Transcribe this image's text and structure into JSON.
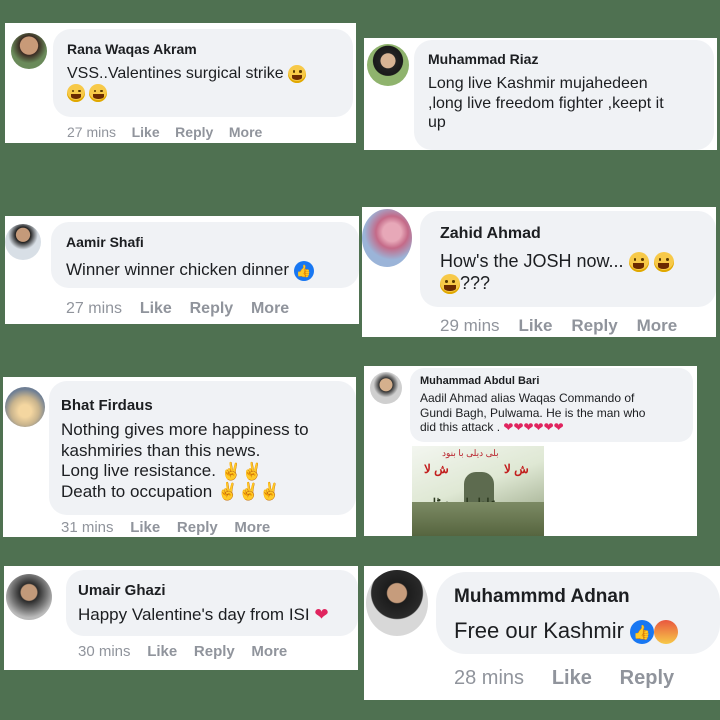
{
  "comments": [
    {
      "author": "Rana Waqas Akram",
      "lines": [
        "VSS..Valentines surgical strike",
        ""
      ],
      "time": "27 mins",
      "actions": [
        "Like",
        "Reply",
        "More"
      ],
      "avatar_icon": "man-portrait"
    },
    {
      "author": "Muhammad Riaz",
      "lines": [
        "Long live Kashmir mujahedeen",
        ",long live freedom fighter ,keept it",
        "up"
      ],
      "time": "",
      "actions": [],
      "avatar_icon": "man-in-black"
    },
    {
      "author": "Aamir Shafi",
      "lines": [
        "Winner winner chicken dinner"
      ],
      "time": "27 mins",
      "actions": [
        "Like",
        "Reply",
        "More"
      ],
      "avatar_icon": "man-in-jersey"
    },
    {
      "author": "Zahid Ahmad",
      "lines": [
        "How's the JOSH now...",
        "???"
      ],
      "time": "29 mins",
      "actions": [
        "Like",
        "Reply",
        "More"
      ],
      "avatar_icon": "flower-avatar"
    },
    {
      "author": "Bhat Firdaus",
      "lines": [
        "Nothing gives more happiness to",
        "kashmiries than this news.",
        "Long live resistance.",
        "Death to occupation"
      ],
      "time": "31 mins",
      "actions": [
        "Like",
        "Reply",
        "More"
      ],
      "avatar_icon": "sunset-avatar"
    },
    {
      "author": "Muhammad Abdul Bari",
      "lines": [
        "Aadil Ahmad alias Waqas Commando of",
        "Gundi Bagh, Pulwama. He is the man who",
        "did this attack ."
      ],
      "time": "",
      "actions": [],
      "avatar_icon": "man-portrait",
      "attachment": {
        "top_urdu": "بلی دیلی با بنود",
        "tag_left": "ش لا",
        "tag_right": "ش لا",
        "urdu_mid": "عادل احمد ڈار"
      }
    },
    {
      "author": "Umair Ghazi",
      "lines": [
        "Happy Valentine's day from ISI"
      ],
      "time": "30 mins",
      "actions": [
        "Like",
        "Reply",
        "More"
      ],
      "avatar_icon": "man-portrait"
    },
    {
      "author": "Muhammmd Adnan",
      "lines": [
        "Free our Kashmir"
      ],
      "time": "28 mins",
      "actions": [
        "Like",
        "Reply"
      ],
      "avatar_icon": "man-in-suit"
    }
  ],
  "colors": {
    "background": "#4f7151",
    "bubble": "#f0f2f5",
    "meta": "#90949c",
    "like_blue": "#1877f2"
  }
}
